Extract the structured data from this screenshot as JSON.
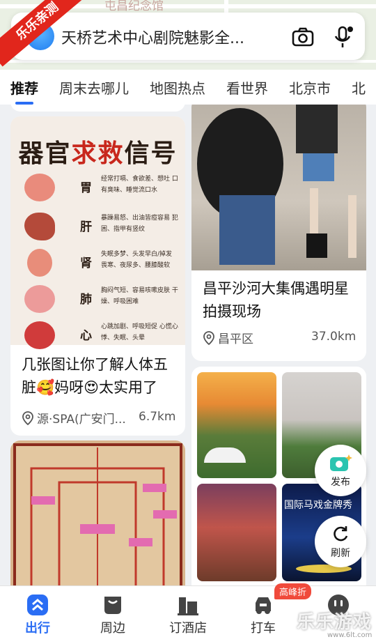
{
  "watermark_corner": "乐乐亲测",
  "map_poi": "屯昌纪念馆",
  "search": {
    "query": "天桥艺术中心剧院魅影全..."
  },
  "tabs": [
    "推荐",
    "周末去哪儿",
    "地图热点",
    "看世界",
    "北京市",
    "北"
  ],
  "cards": {
    "organs": {
      "heading_a": "器官",
      "heading_red": "求救",
      "heading_b": "信号",
      "rows": [
        {
          "name": "胃",
          "desc": "经常打嗝、食欲差、想吐 口有臭味、睡觉流口水"
        },
        {
          "name": "肝",
          "desc": "暴躁易怒、出油皆痘容易 犯困、指甲有竖纹"
        },
        {
          "name": "肾",
          "desc": "失眠多梦、头发早白/掉发 畏寒、夜尿多、腰膝酸软"
        },
        {
          "name": "肺",
          "desc": "胸闷气短、容易咳嗽皮肤 干燥、呼吸困难"
        },
        {
          "name": "心",
          "desc": "心跳加剧、呼吸短促 心慌心悸、失眠、头晕"
        }
      ],
      "title": "几张图让你了解人体五脏🥰妈呀😍太实用了",
      "location": "源·SPA(广安门...",
      "distance": "6.7km"
    },
    "star": {
      "title": "昌平沙河大集偶遇明星拍摄现场",
      "location": "昌平区",
      "distance": "37.0km"
    },
    "collage": {
      "circus_caption": "国际马戏金牌秀"
    }
  },
  "fab": {
    "publish": "发布",
    "refresh": "刷新"
  },
  "nav": [
    {
      "label": "出行",
      "icon": "chevrons-up-icon",
      "active": true
    },
    {
      "label": "周边",
      "icon": "bag-icon",
      "active": false
    },
    {
      "label": "订酒店",
      "icon": "hotel-icon",
      "active": false
    },
    {
      "label": "打车",
      "icon": "car-icon",
      "active": false,
      "badge": "高峰折"
    },
    {
      "label": "",
      "icon": "chat-face-icon",
      "active": false
    }
  ],
  "brand_watermark": "乐乐游戏",
  "brand_url": "www.6lt.com"
}
